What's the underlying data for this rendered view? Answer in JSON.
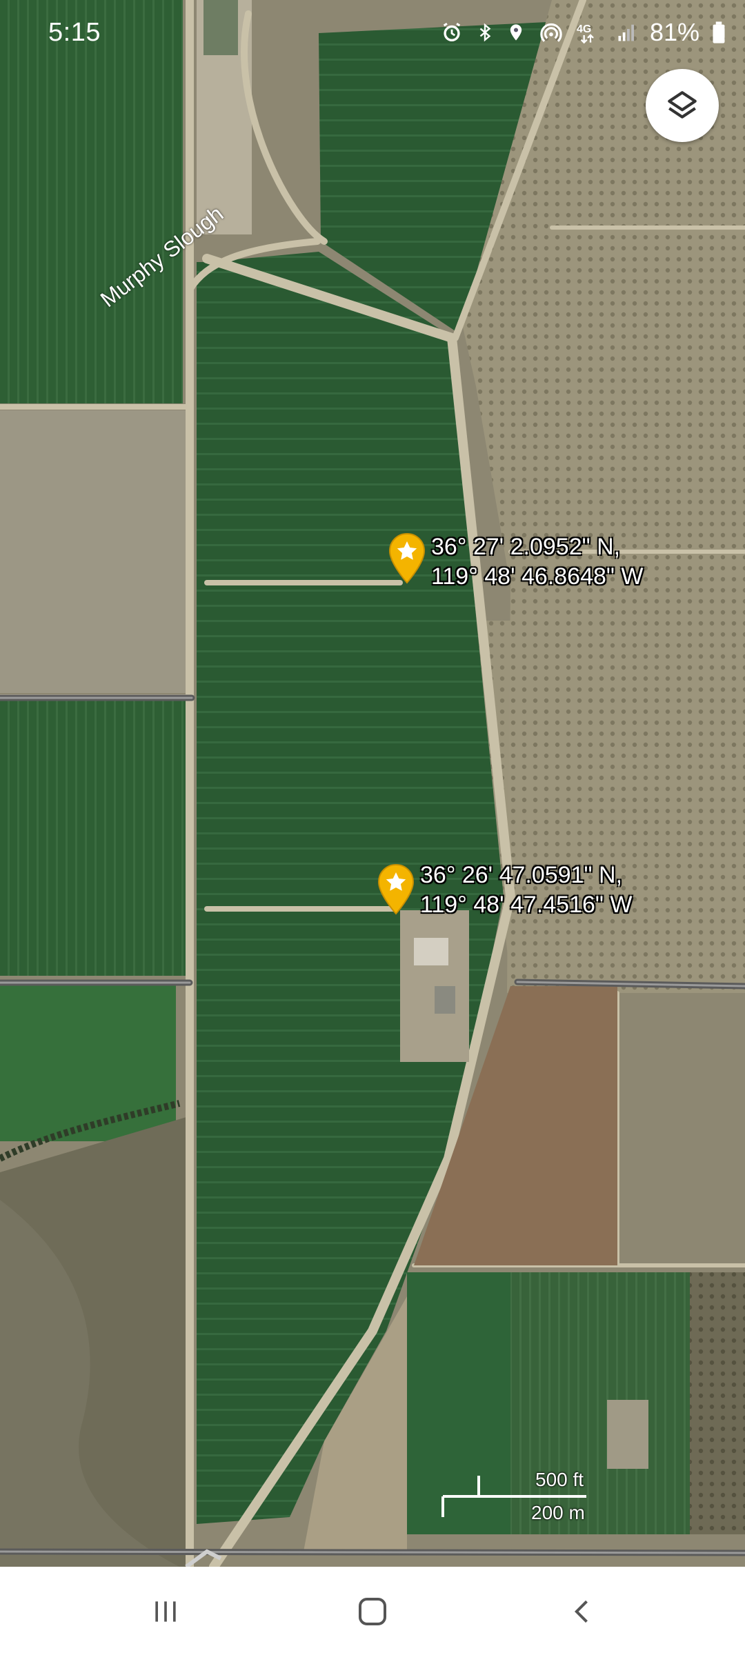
{
  "status_bar": {
    "time": "5:15",
    "battery_percent": "81%",
    "icons": [
      "alarm-icon",
      "bluetooth-icon",
      "location-icon",
      "hotspot-icon",
      "lte-data-icon",
      "signal-icon",
      "battery-icon"
    ]
  },
  "map": {
    "type": "satellite",
    "labels": {
      "slough": "Murphy Slough"
    },
    "pins": [
      {
        "lat": "36° 27' 2.0952\" N,",
        "lon": "119° 48' 46.8648\" W",
        "icon": "star-pin-icon",
        "color": "#f4b400"
      },
      {
        "lat": "36° 26' 47.0591\" N,",
        "lon": "119° 48' 47.4516\" W",
        "icon": "star-pin-icon",
        "color": "#f4b400"
      }
    ],
    "scale": {
      "imperial": "500 ft",
      "metric": "200 m"
    }
  },
  "controls": {
    "layers_icon": "layers-icon"
  },
  "nav_bar": {
    "items": [
      "recents-icon",
      "home-icon",
      "back-icon"
    ]
  }
}
